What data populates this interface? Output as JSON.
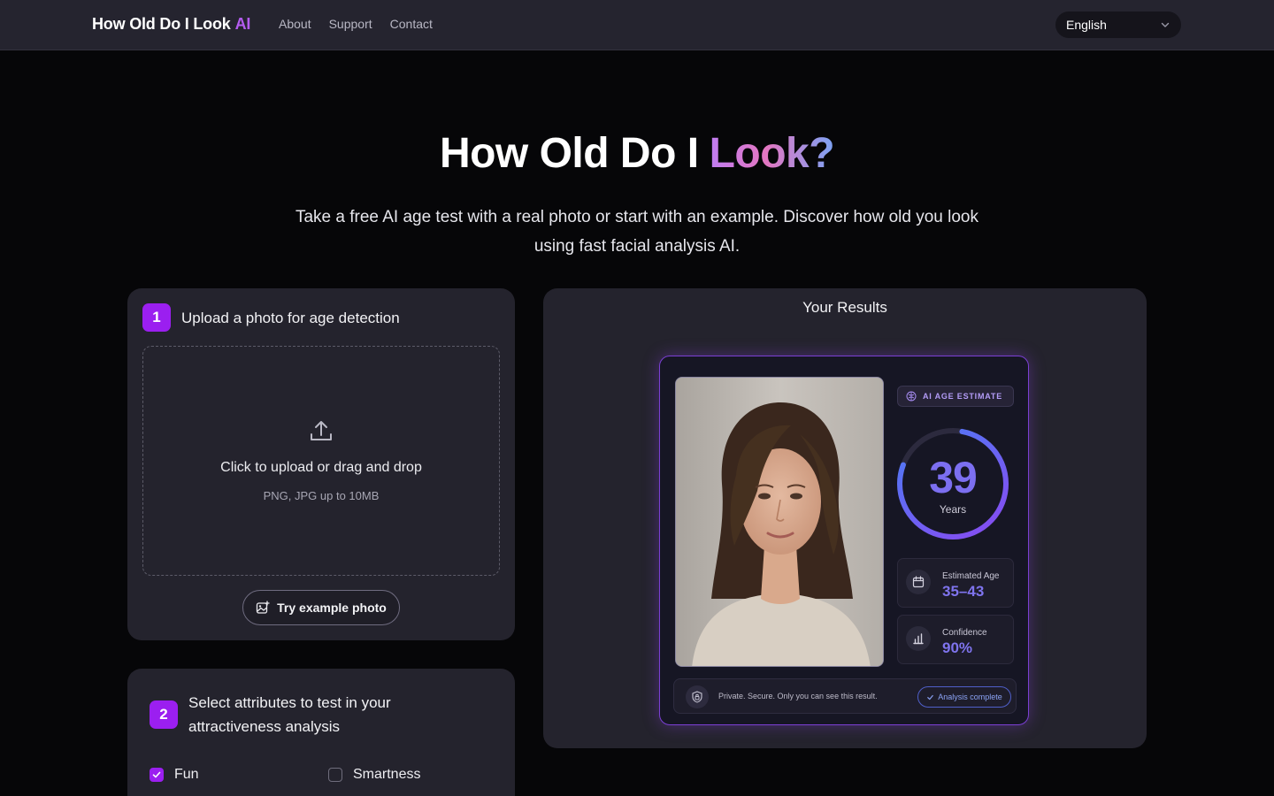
{
  "nav": {
    "brand_main": "How Old Do I Look",
    "brand_ai": "AI",
    "links": [
      "About",
      "Support",
      "Contact"
    ],
    "language": "English"
  },
  "hero": {
    "title_main": "How Old Do I",
    "title_accent": "Look?",
    "subtitle": "Take a free AI age test with a real photo or start with an example. Discover how old you look using fast facial analysis AI."
  },
  "upload": {
    "step": "1",
    "title": "Upload a photo for age detection",
    "drop_main": "Click to upload or drag and drop",
    "drop_sub": "PNG, JPG up to 10MB",
    "example_button": "Try example photo"
  },
  "attributes": {
    "step": "2",
    "title": "Select attributes to test in your attractiveness analysis",
    "options": [
      {
        "label": "Fun",
        "checked": true
      },
      {
        "label": "Smartness",
        "checked": false
      }
    ]
  },
  "results": {
    "title": "Your Results",
    "estimate_label": "AI AGE ESTIMATE",
    "age": "39",
    "age_unit": "Years",
    "age_progress": 0.78,
    "estimated_age_label": "Estimated Age",
    "estimated_age_value": "35–43",
    "confidence_label": "Confidence",
    "confidence_value": "90%",
    "privacy_text": "Private. Secure. Only you can see this result.",
    "status_badge": "Analysis complete"
  },
  "colors": {
    "accent": "#9b1ff0",
    "background": "#060608",
    "card": "#24232d",
    "nav": "#25242f"
  }
}
